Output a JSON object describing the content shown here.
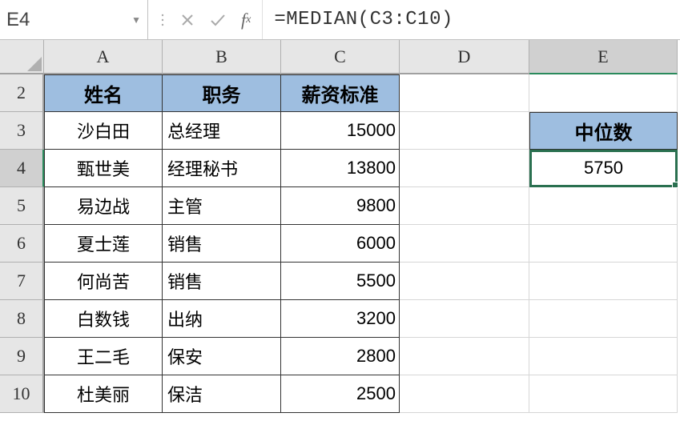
{
  "name_box": "E4",
  "formula": "=MEDIAN(C3:C10)",
  "columns": [
    "A",
    "B",
    "C",
    "D",
    "E"
  ],
  "active_column": "E",
  "rows": [
    2,
    3,
    4,
    5,
    6,
    7,
    8,
    9,
    10
  ],
  "active_row": 4,
  "table": {
    "headers": [
      "姓名",
      "职务",
      "薪资标准"
    ],
    "data": [
      {
        "name": "沙白田",
        "role": "总经理",
        "salary": "15000"
      },
      {
        "name": "甄世美",
        "role": "经理秘书",
        "salary": "13800"
      },
      {
        "name": "易边战",
        "role": "主管",
        "salary": "9800"
      },
      {
        "name": "夏士莲",
        "role": "销售",
        "salary": "6000"
      },
      {
        "name": "何尚苦",
        "role": "销售",
        "salary": "5500"
      },
      {
        "name": "白数钱",
        "role": "出纳",
        "salary": "3200"
      },
      {
        "name": "王二毛",
        "role": "保安",
        "salary": "2800"
      },
      {
        "name": "杜美丽",
        "role": "保洁",
        "salary": "2500"
      }
    ]
  },
  "median": {
    "label": "中位数",
    "value": "5750"
  }
}
